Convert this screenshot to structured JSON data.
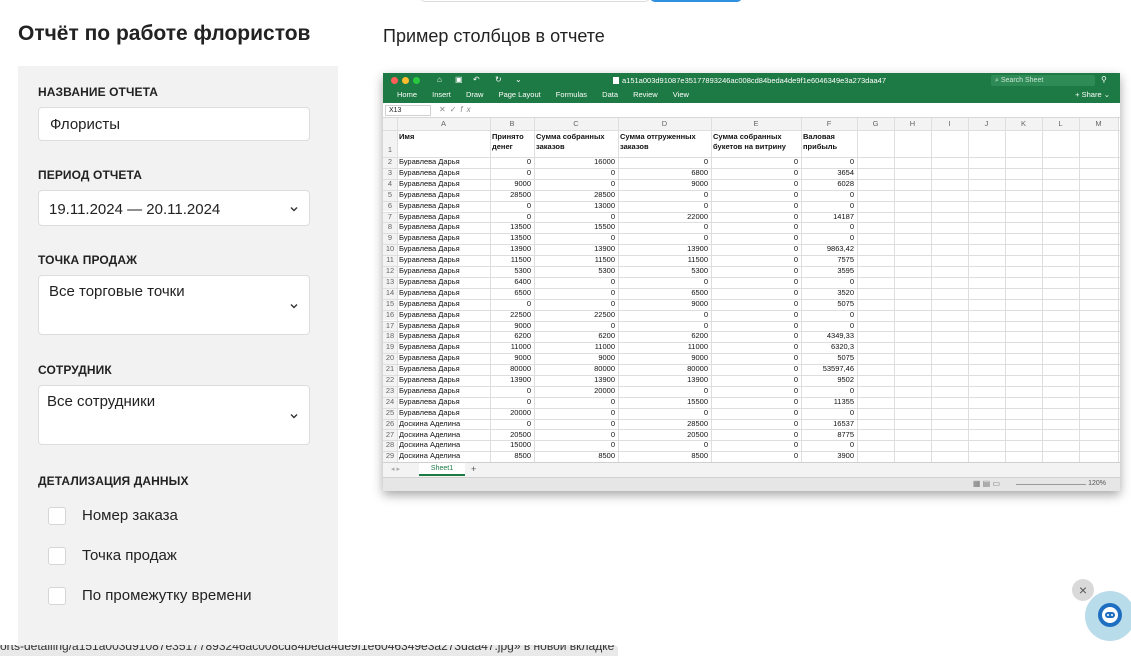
{
  "page": {
    "title": "Отчёт по работе флористов",
    "sample_title": "Пример столбцов в отчете"
  },
  "form": {
    "name_label": "НАЗВАНИЕ ОТЧЕТА",
    "name_value": "Флористы",
    "period_label": "ПЕРИОД ОТЧЕТА",
    "period_value": "19.11.2024 — 20.11.2024",
    "store_label": "ТОЧКА ПРОДАЖ",
    "store_value": "Все торговые точки",
    "employee_label": "СОТРУДНИК",
    "employee_value": "Все сотрудники",
    "detail_label": "ДЕТАЛИЗАЦИЯ ДАННЫХ",
    "detail_options": [
      "Номер заказа",
      "Точка продаж",
      "По промежутку времени"
    ]
  },
  "excel": {
    "filename": "a151a003d91087e35177893246ac008cd84beda4de9f1e6046349e3a273daa47",
    "search_placeholder": "Search Sheet",
    "ribbon_tabs": [
      "Home",
      "Insert",
      "Draw",
      "Page Layout",
      "Formulas",
      "Data",
      "Review",
      "View"
    ],
    "share_label": "Share",
    "cell_ref": "X13",
    "fx_label": "fx",
    "sheet_tab": "Sheet1",
    "add_sheet": "+",
    "zoom": "120%",
    "column_letters": [
      "A",
      "B",
      "C",
      "D",
      "E",
      "F",
      "G",
      "H",
      "I",
      "J",
      "K",
      "L",
      "M"
    ],
    "header_row": [
      "Имя",
      "Принято денег",
      "Сумма собранных заказов",
      "Сумма отгруженных заказов",
      "Сумма собранных букетов на витрину",
      "Валовая прибыль"
    ],
    "header_row_lines": [
      [
        "Имя",
        ""
      ],
      [
        "Принято",
        "денег"
      ],
      [
        "Сумма собранных",
        "заказов"
      ],
      [
        "Сумма отгруженных",
        "заказов"
      ],
      [
        "Сумма собранных",
        "букетов на витрину"
      ],
      [
        "Валовая",
        "прибыль"
      ]
    ],
    "rows": [
      [
        "2",
        "Буравлева Дарья",
        "0",
        "16000",
        "0",
        "0",
        "0"
      ],
      [
        "3",
        "Буравлева Дарья",
        "0",
        "0",
        "6800",
        "0",
        "3654"
      ],
      [
        "4",
        "Буравлева Дарья",
        "9000",
        "0",
        "9000",
        "0",
        "6028"
      ],
      [
        "5",
        "Буравлева Дарья",
        "28500",
        "28500",
        "0",
        "0",
        "0"
      ],
      [
        "6",
        "Буравлева Дарья",
        "0",
        "13000",
        "0",
        "0",
        "0"
      ],
      [
        "7",
        "Буравлева Дарья",
        "0",
        "0",
        "22000",
        "0",
        "14187"
      ],
      [
        "8",
        "Буравлева Дарья",
        "13500",
        "15500",
        "0",
        "0",
        "0"
      ],
      [
        "9",
        "Буравлева Дарья",
        "13500",
        "0",
        "0",
        "0",
        "0"
      ],
      [
        "10",
        "Буравлева Дарья",
        "13900",
        "13900",
        "13900",
        "0",
        "9863,42"
      ],
      [
        "11",
        "Буравлева Дарья",
        "11500",
        "11500",
        "11500",
        "0",
        "7575"
      ],
      [
        "12",
        "Буравлева Дарья",
        "5300",
        "5300",
        "5300",
        "0",
        "3595"
      ],
      [
        "13",
        "Буравлева Дарья",
        "6400",
        "0",
        "0",
        "0",
        "0"
      ],
      [
        "14",
        "Буравлева Дарья",
        "6500",
        "0",
        "6500",
        "0",
        "3520"
      ],
      [
        "15",
        "Буравлева Дарья",
        "0",
        "0",
        "9000",
        "0",
        "5075"
      ],
      [
        "16",
        "Буравлева Дарья",
        "22500",
        "22500",
        "0",
        "0",
        "0"
      ],
      [
        "17",
        "Буравлева Дарья",
        "9000",
        "0",
        "0",
        "0",
        "0"
      ],
      [
        "18",
        "Буравлева Дарья",
        "6200",
        "6200",
        "6200",
        "0",
        "4349,33"
      ],
      [
        "19",
        "Буравлева Дарья",
        "11000",
        "11000",
        "11000",
        "0",
        "6320,3"
      ],
      [
        "20",
        "Буравлева Дарья",
        "9000",
        "9000",
        "9000",
        "0",
        "5075"
      ],
      [
        "21",
        "Буравлева Дарья",
        "80000",
        "80000",
        "80000",
        "0",
        "53597,46"
      ],
      [
        "22",
        "Буравлева Дарья",
        "13900",
        "13900",
        "13900",
        "0",
        "9502"
      ],
      [
        "23",
        "Буравлева Дарья",
        "0",
        "20000",
        "0",
        "0",
        "0"
      ],
      [
        "24",
        "Буравлева Дарья",
        "0",
        "0",
        "15500",
        "0",
        "11355"
      ],
      [
        "25",
        "Буравлева Дарья",
        "20000",
        "0",
        "0",
        "0",
        "0"
      ],
      [
        "26",
        "Доскина Аделина",
        "0",
        "0",
        "28500",
        "0",
        "16537"
      ],
      [
        "27",
        "Доскина Аделина",
        "20500",
        "0",
        "20500",
        "0",
        "8775"
      ],
      [
        "28",
        "Доскина Аделина",
        "15000",
        "0",
        "0",
        "0",
        "0"
      ],
      [
        "29",
        "Доскина Аделина",
        "8500",
        "8500",
        "8500",
        "0",
        "3900"
      ]
    ]
  },
  "chat": {
    "close_label": "×"
  },
  "statusbar": {
    "text": "orts-detailing/a151a003d91087e35177893246ac008cd84beda4de9f1e6046349e3a273daa47.jpg» в новой вкладке"
  }
}
